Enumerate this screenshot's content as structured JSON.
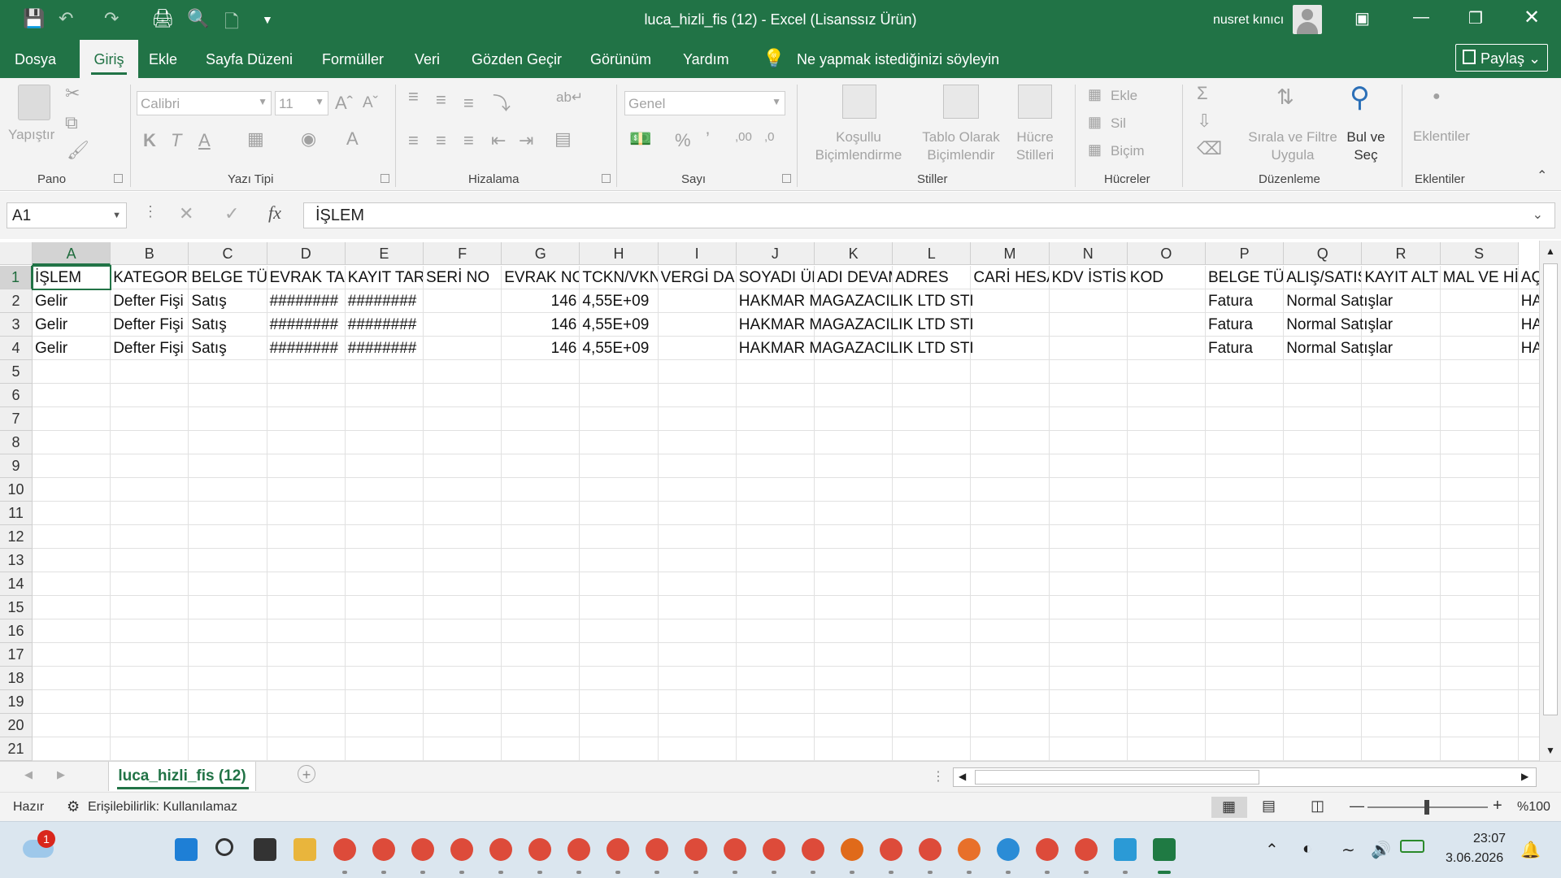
{
  "window": {
    "title": "luca_hizli_fis (12)  -  Excel (Lisanssız Ürün)",
    "user": "nusret kınıcı",
    "accent_color": "#217346"
  },
  "menu": {
    "tabs": [
      "Dosya",
      "Giriş",
      "Ekle",
      "Sayfa Düzeni",
      "Formüller",
      "Veri",
      "Gözden Geçir",
      "Görünüm",
      "Yardım"
    ],
    "active_tab": "Giriş",
    "tell_me": "Ne yapmak istediğinizi söyleyin",
    "share": "Paylaş"
  },
  "ribbon": {
    "groups": {
      "clipboard": "Pano",
      "font": "Yazı Tipi",
      "alignment": "Hizalama",
      "number": "Sayı",
      "styles": "Stiller",
      "cells": "Hücreler",
      "editing": "Düzenleme",
      "addins": "Eklentiler"
    },
    "paste": "Yapıştır",
    "font_name": "Calibri",
    "font_size": "11",
    "number_format": "Genel",
    "conditional_1": "Koşullu",
    "conditional_2": "Biçimlendirme",
    "table_1": "Tablo Olarak",
    "table_2": "Biçimlendir",
    "cellstyle_1": "Hücre",
    "cellstyle_2": "Stilleri",
    "insert": "Ekle",
    "delete": "Sil",
    "format": "Biçim",
    "sort_1": "Sırala ve Filtre",
    "sort_2": "Uygula",
    "find_1": "Bul ve",
    "find_2": "Seç",
    "addins": "Eklentiler"
  },
  "formula_bar": {
    "name_box": "A1",
    "content": "İŞLEM"
  },
  "grid": {
    "columns": [
      "A",
      "B",
      "C",
      "D",
      "E",
      "F",
      "G",
      "H",
      "I",
      "J",
      "K",
      "L",
      "M",
      "N",
      "O",
      "P",
      "Q",
      "R",
      "S"
    ],
    "rows": [
      "1",
      "2",
      "3",
      "4",
      "5",
      "6",
      "7",
      "8",
      "9",
      "10",
      "11",
      "12",
      "13",
      "14",
      "15",
      "16",
      "17",
      "18",
      "19",
      "20",
      "21"
    ],
    "header_row": [
      "İŞLEM",
      "KATEGORİ",
      "BELGE TÜR",
      "EVRAK TAR",
      "KAYIT TAR",
      "SERİ NO",
      "EVRAK NO",
      "TCKN/VKN",
      "VERGİ DAİ",
      "SOYADI ÜN",
      "ADI DEVAM",
      "ADRES",
      "CARİ HESA",
      "KDV İSTİSN",
      "KOD",
      "BELGE TÜR",
      "ALIŞ/SATIŞ",
      "KAYIT ALT",
      "MAL VE Hİ",
      "AÇ"
    ],
    "data_rows": [
      [
        "Gelir",
        "Defter Fişi",
        "Satış",
        "########",
        "########",
        "",
        "146",
        "4,55E+09",
        "",
        "HAKMAR MAGAZACILIK LTD STI",
        "",
        "",
        "",
        "",
        "",
        "Fatura",
        "Normal Satışlar",
        "",
        "",
        "HA"
      ],
      [
        "Gelir",
        "Defter Fişi",
        "Satış",
        "########",
        "########",
        "",
        "146",
        "4,55E+09",
        "",
        "HAKMAR MAGAZACILIK LTD STI",
        "",
        "",
        "",
        "",
        "",
        "Fatura",
        "Normal Satışlar",
        "",
        "",
        "HA"
      ],
      [
        "Gelir",
        "Defter Fişi",
        "Satış",
        "########",
        "########",
        "",
        "146",
        "4,55E+09",
        "",
        "HAKMAR MAGAZACILIK LTD STI",
        "",
        "",
        "",
        "",
        "",
        "Fatura",
        "Normal Satışlar",
        "",
        "",
        "HA"
      ]
    ]
  },
  "sheets": {
    "active": "luca_hizli_fis (12)"
  },
  "status": {
    "ready": "Hazır",
    "accessibility": "Erişilebilirlik: Kullanılamaz",
    "zoom": "%100"
  },
  "taskbar": {
    "time": "23:07",
    "date": "3.06.2026",
    "weather_badge": "1"
  }
}
